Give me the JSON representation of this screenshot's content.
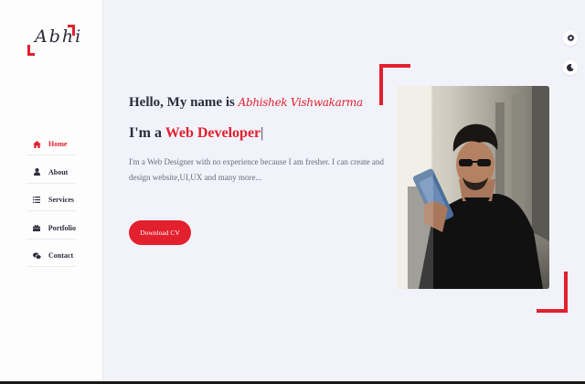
{
  "logo": {
    "text": "Abhi"
  },
  "sidebar": {
    "items": [
      {
        "label": "Home",
        "icon": "home-icon",
        "active": true
      },
      {
        "label": "About",
        "icon": "user-icon",
        "active": false
      },
      {
        "label": "Services",
        "icon": "list-icon",
        "active": false
      },
      {
        "label": "Portfolio",
        "icon": "briefcase-icon",
        "active": false
      },
      {
        "label": "Contact",
        "icon": "chat-icon",
        "active": false
      }
    ]
  },
  "top_icons": [
    {
      "icon": "gear-icon"
    },
    {
      "icon": "moon-icon"
    }
  ],
  "hero": {
    "greeting": "Hello, My name is",
    "name": "Abhishek Vishwakarma",
    "role_prefix": "I'm a",
    "role_highlight": "Web Developer",
    "caret": "|",
    "description": "I'm a Web Designer with no experience because I am fresher. I can create and design website,UI,UX and many more...",
    "cv_button": "Download CV"
  },
  "colors": {
    "accent": "#e3202e",
    "text": "#2c2c3a",
    "background": "#f2f3fa",
    "sidebar": "#fdfdfe"
  }
}
